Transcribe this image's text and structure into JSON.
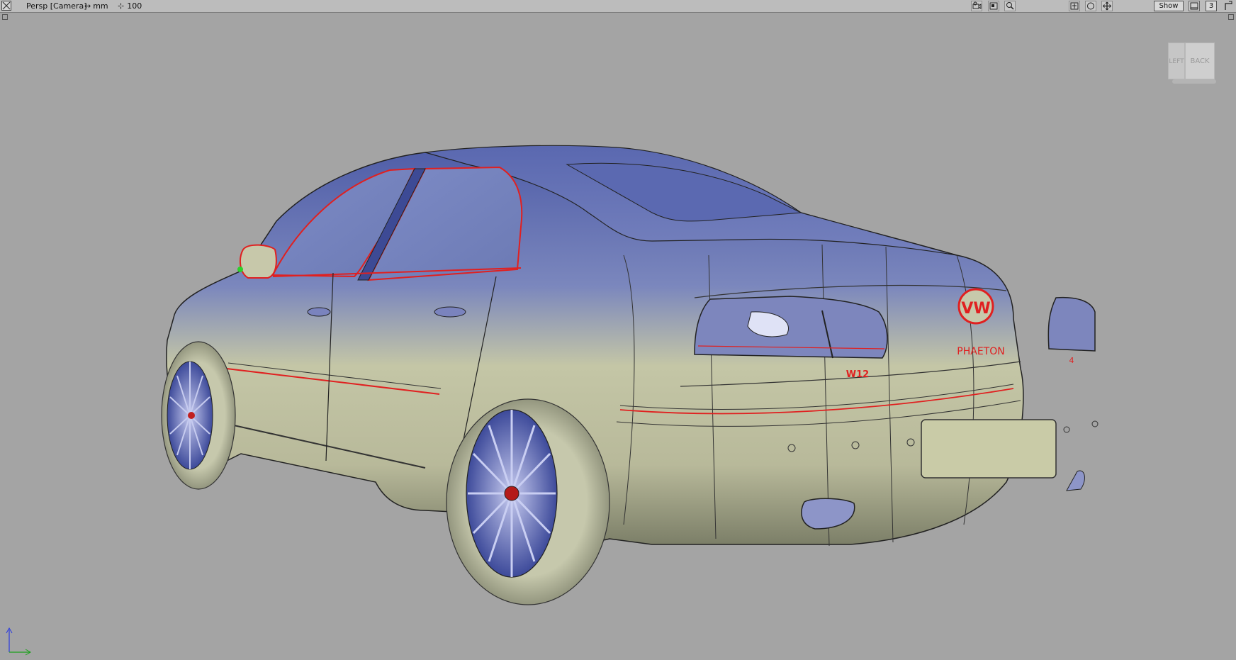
{
  "viewport": {
    "camera_label": "Persp [Camera]",
    "units_label": "mm",
    "scale_label": "100",
    "show_label": "Show",
    "layout_number": "3"
  },
  "viewcube": {
    "left_face": "LEFT",
    "back_face": "BACK"
  },
  "car_badges": {
    "logo": "VW",
    "model": "PHAETON",
    "engine": "W12",
    "small_badge": "4"
  },
  "colors": {
    "background": "#a4a4a4",
    "toolbar": "#bcbcbc",
    "highlight": "#e02020",
    "body_top": "#6b78b8",
    "body_bottom": "#c9cca4"
  },
  "icons": [
    "close-icon",
    "camera-icon",
    "render-icon",
    "zoom-icon",
    "frame-icon",
    "sphere-icon",
    "move-icon",
    "layout-icon",
    "maximize-icon",
    "axis-icon"
  ]
}
